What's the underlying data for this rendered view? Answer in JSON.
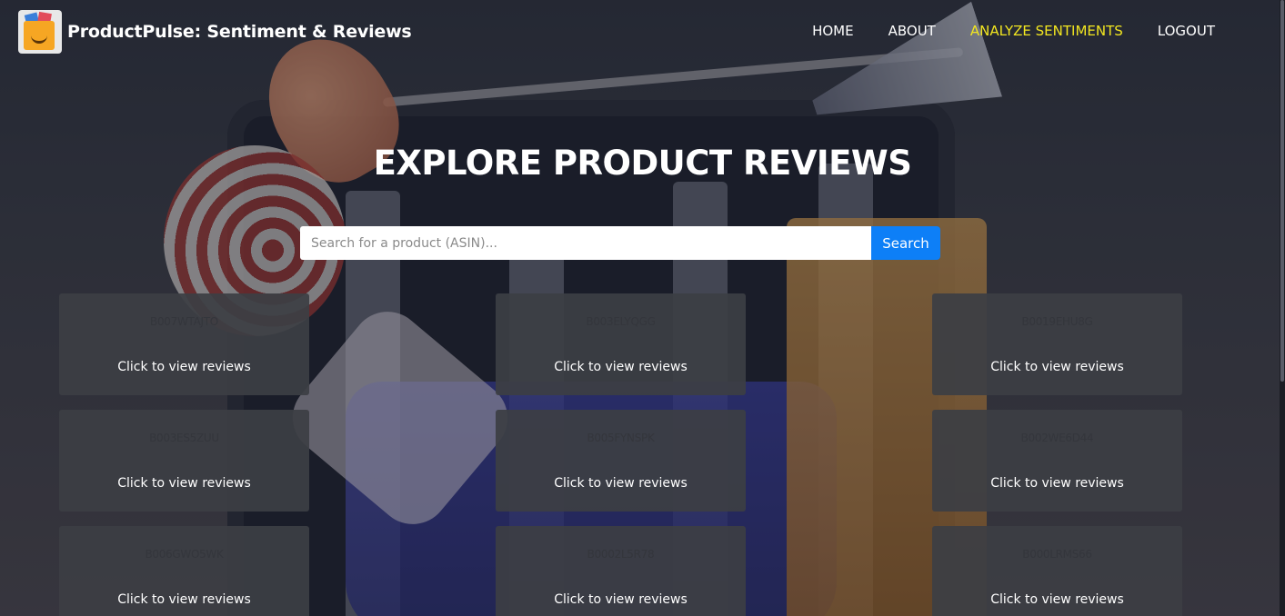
{
  "header": {
    "brand_title": "ProductPulse: Sentiment & Reviews",
    "nav": [
      {
        "label": "HOME",
        "active": false
      },
      {
        "label": "ABOUT",
        "active": false
      },
      {
        "label": "ANALYZE SENTIMENTS",
        "active": true
      },
      {
        "label": "LOGOUT",
        "active": false
      }
    ]
  },
  "hero": {
    "title": "EXPLORE PRODUCT REVIEWS"
  },
  "search": {
    "placeholder": "Search for a product (ASIN)...",
    "value": "",
    "button_label": "Search"
  },
  "products": [
    {
      "asin": "B007WTAJTO",
      "cta": "Click to view reviews"
    },
    {
      "asin": "B003ELYQGG",
      "cta": "Click to view reviews"
    },
    {
      "asin": "B0019EHU8G",
      "cta": "Click to view reviews"
    },
    {
      "asin": "B003ES5ZUU",
      "cta": "Click to view reviews"
    },
    {
      "asin": "B005FYNSPK",
      "cta": "Click to view reviews"
    },
    {
      "asin": "B002WE6D44",
      "cta": "Click to view reviews"
    },
    {
      "asin": "B006GWO5WK",
      "cta": "Click to view reviews"
    },
    {
      "asin": "B0002L5R78",
      "cta": "Click to view reviews"
    },
    {
      "asin": "B000LRMS66",
      "cta": "Click to view reviews"
    }
  ],
  "colors": {
    "accent_nav_active": "#f2e620",
    "search_button": "#0d7ff7",
    "card_background": "#3c3e44"
  },
  "icons": {
    "logo": "shopping-bag-logo-icon"
  }
}
